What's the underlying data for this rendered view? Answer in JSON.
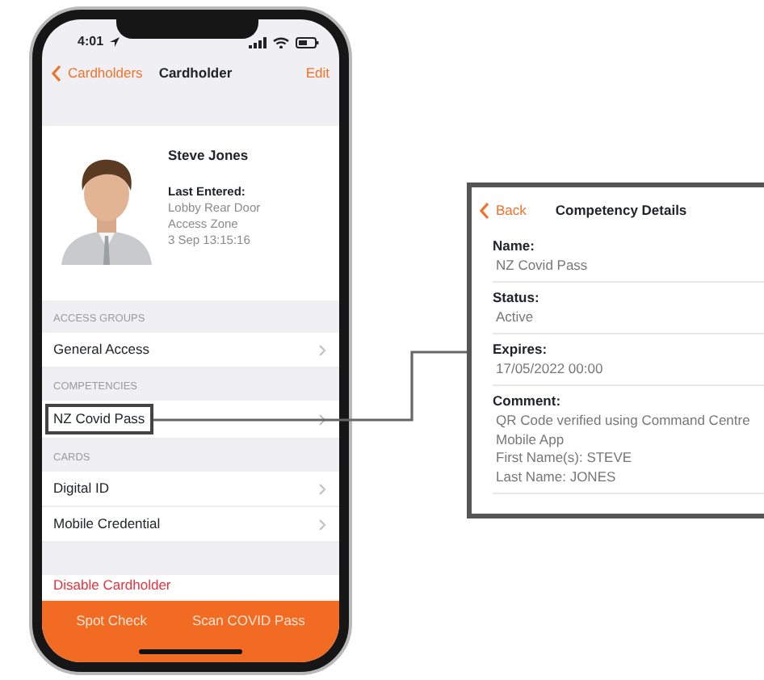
{
  "phone": {
    "status_bar": {
      "time": "4:01"
    },
    "nav": {
      "back": "Cardholders",
      "title": "Cardholder",
      "action": "Edit"
    },
    "profile": {
      "name": "Steve Jones",
      "last_entered_label": "Last Entered:",
      "details": [
        "Lobby Rear Door",
        "Access Zone",
        "3 Sep 13:15:16"
      ]
    },
    "sections": [
      {
        "header": "ACCESS GROUPS",
        "items": [
          {
            "label": "General Access",
            "highlighted": false
          }
        ]
      },
      {
        "header": "COMPETENCIES",
        "items": [
          {
            "label": "NZ Covid Pass",
            "highlighted": true
          }
        ]
      },
      {
        "header": "CARDS",
        "items": [
          {
            "label": "Digital ID",
            "highlighted": false
          },
          {
            "label": "Mobile Credential",
            "highlighted": false
          }
        ]
      }
    ],
    "danger_action": "Disable Cardholder",
    "bottom_bar": [
      "Spot Check",
      "Scan COVID Pass"
    ]
  },
  "callout": {
    "back": "Back",
    "title": "Competency Details",
    "fields": [
      {
        "label": "Name:",
        "lines": [
          "NZ Covid Pass"
        ]
      },
      {
        "label": "Status:",
        "lines": [
          "Active"
        ]
      },
      {
        "label": "Expires:",
        "lines": [
          "17/05/2022 00:00"
        ]
      },
      {
        "label": "Comment:",
        "lines": [
          "QR Code verified using Command Centre",
          "Mobile App",
          "First Name(s): STEVE",
          "Last Name: JONES"
        ]
      }
    ]
  }
}
